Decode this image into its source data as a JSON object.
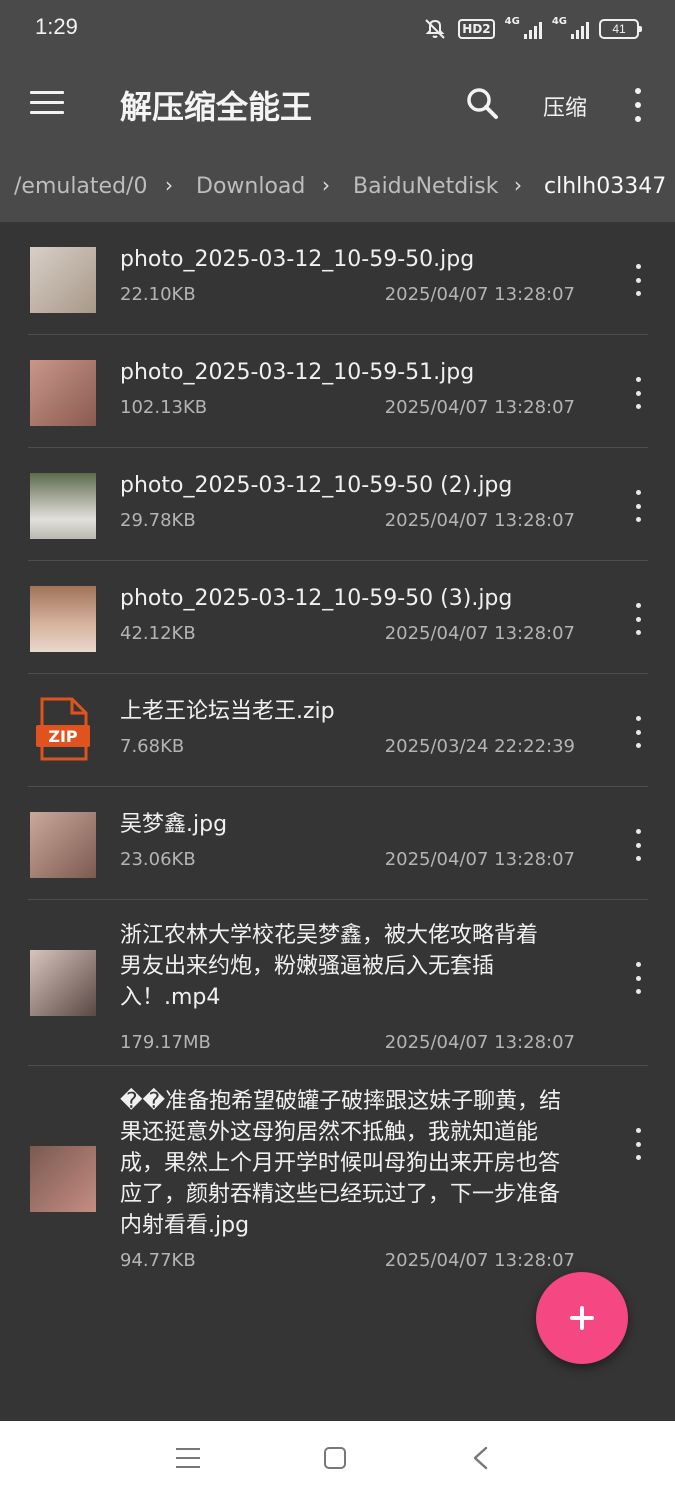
{
  "status_bar": {
    "time": "1:29",
    "hd_label": "HD2",
    "net1": "4G",
    "net2": "4G",
    "battery": "41"
  },
  "toolbar": {
    "title": "解压缩全能王",
    "compress_label": "压缩",
    "icons": [
      "menu-icon",
      "search-icon",
      "more-vert-icon"
    ]
  },
  "breadcrumb": [
    {
      "label": "/emulated/0"
    },
    {
      "label": "Download"
    },
    {
      "label": "BaiduNetdisk"
    },
    {
      "label": "clhlh03347"
    }
  ],
  "files": [
    {
      "name": "photo_2025-03-12_10-59-50.jpg",
      "size": "22.10KB",
      "date": "2025/04/07 13:28:07",
      "type": "image"
    },
    {
      "name": "photo_2025-03-12_10-59-51.jpg",
      "size": "102.13KB",
      "date": "2025/04/07 13:28:07",
      "type": "image"
    },
    {
      "name": "photo_2025-03-12_10-59-50 (2).jpg",
      "size": "29.78KB",
      "date": "2025/04/07 13:28:07",
      "type": "image"
    },
    {
      "name": "photo_2025-03-12_10-59-50 (3).jpg",
      "size": "42.12KB",
      "date": "2025/04/07 13:28:07",
      "type": "image"
    },
    {
      "name": "上老王论坛当老王.zip",
      "size": "7.68KB",
      "date": "2025/03/24 22:22:39",
      "type": "zip",
      "icon_label": "ZIP"
    },
    {
      "name": "吴梦鑫.jpg",
      "size": "23.06KB",
      "date": "2025/04/07 13:28:07",
      "type": "image"
    },
    {
      "name": "浙江农林大学校花吴梦鑫，被大佬攻略背着 男友出来约炮，粉嫩骚逼被后入无套插入！.mp4",
      "size": "179.17MB",
      "date": "2025/04/07 13:28:07",
      "type": "video"
    },
    {
      "name": "��准备抱希望破罐子破摔跟这妹子聊黄，结果还挺意外这母狗居然不抵触，我就知道能成，果然上个月开学时候叫母狗出来开房也答应了，颜射吞精这些已经玩过了，下一步准备内射看看.jpg",
      "size": "94.77KB",
      "date": "2025/04/07 13:28:07",
      "type": "image"
    }
  ],
  "fab": {
    "icon": "plus-icon",
    "color": "#f54882"
  },
  "nav_bar": {
    "icons": [
      "recent-apps-icon",
      "home-icon",
      "back-icon"
    ]
  },
  "colors": {
    "bar": "#4a4a4a",
    "background": "#353535",
    "zip_orange": "#e0531f"
  }
}
